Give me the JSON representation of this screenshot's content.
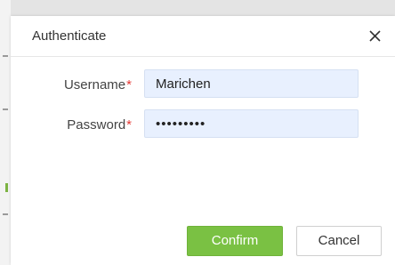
{
  "dialog": {
    "title": "Authenticate",
    "close_icon": "close-icon"
  },
  "form": {
    "username": {
      "label": "Username",
      "required_mark": "*",
      "value": "Marichen"
    },
    "password": {
      "label": "Password",
      "required_mark": "*",
      "value": "•••••••••"
    }
  },
  "buttons": {
    "confirm_label": "Confirm",
    "cancel_label": "Cancel"
  },
  "colors": {
    "confirm_bg": "#7ac143",
    "required": "#e53935",
    "input_bg": "#e8f0fe"
  }
}
